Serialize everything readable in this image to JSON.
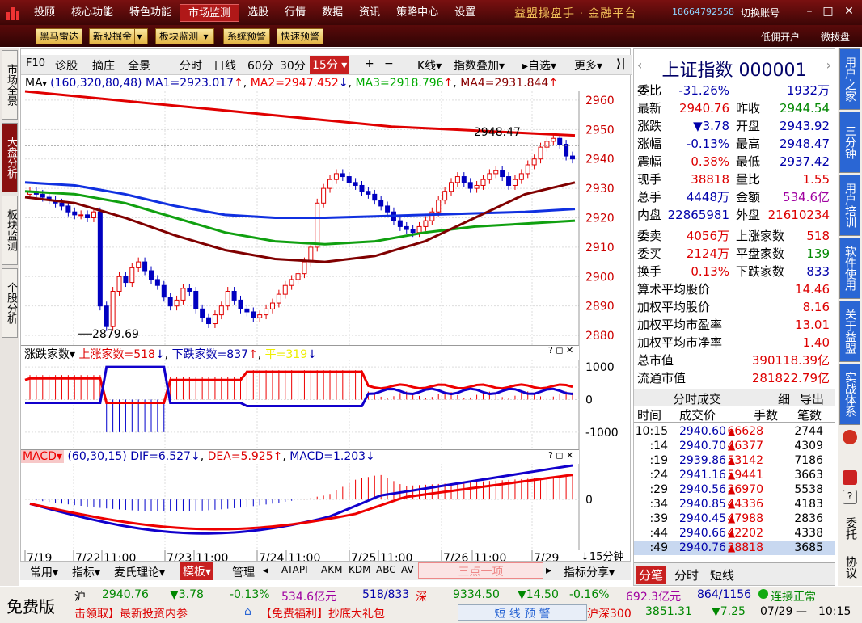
{
  "topbar": {
    "menu": [
      "投顾",
      "核心功能",
      "特色功能",
      "市场监测",
      "选股",
      "行情",
      "数据",
      "资讯",
      "策略中心",
      "设置"
    ],
    "active": "市场监测",
    "brand": "益盟操盘手 · 金融平台",
    "phone": "18664792558",
    "switch": "切换账号"
  },
  "toolbar2": {
    "buttons": [
      "黑马雷达",
      "新股掘金",
      "板块监测",
      "系统预警",
      "快速预警"
    ],
    "right": [
      "低佣开户",
      "微拨盘"
    ]
  },
  "left_tabs": [
    "市场全景",
    "大盘分析",
    "板块监测",
    "个股分析"
  ],
  "chart_toolbar": {
    "items": [
      "F10",
      "诊股",
      "摘庄",
      "全景",
      "分时",
      "日线",
      "60分",
      "30分",
      "15分",
      "+",
      "−",
      "K线",
      "指数叠加",
      "自选",
      "更多"
    ],
    "active": "15分"
  },
  "ma_header": {
    "label": "MA",
    "params": "(160,320,80,48)",
    "ma1": "MA1=2923.017",
    "ma2": "MA2=2947.452",
    "ma3": "MA3=2918.796",
    "ma4": "MA4=2931.844"
  },
  "price_axis": [
    "2960",
    "2950",
    "2940",
    "2930",
    "2920",
    "2910",
    "2900",
    "2890",
    "2880"
  ],
  "annotations": {
    "high": "2948.47",
    "low": "2879.69"
  },
  "breadth_header": {
    "label": "涨跌家数",
    "up": "上涨家数=518",
    "down": "下跌家数=837",
    "flat": "平=319"
  },
  "breadth_axis": [
    "1000",
    "0",
    "-1000"
  ],
  "macd_header": {
    "label": "MACD",
    "params": "(60,30,15)",
    "dif": "DIF=6.527",
    "dea": "DEA=5.925",
    "macd": "MACD=1.203"
  },
  "macd_axis": [
    "0"
  ],
  "date_axis": [
    "7/19",
    "7/22",
    "11:00",
    "7/23",
    "11:00",
    "7/24",
    "11:00",
    "7/25",
    "11:00",
    "7/26",
    "11:00",
    "7/29"
  ],
  "period_label": "15分钟",
  "bottom_tabs": [
    "常用",
    "指标",
    "麦氏理论",
    "模板",
    "管理",
    "ATAPI",
    "AKM",
    "KDM",
    "ABC",
    "AV",
    "三点一项",
    "指标分享"
  ],
  "quote": {
    "title": "上证指数",
    "code": "000001",
    "rows": [
      [
        "委比",
        "-31.26%",
        "",
        "1932万"
      ],
      [
        "最新",
        "2940.76",
        "昨收",
        "2944.54"
      ],
      [
        "涨跌",
        "▼3.78",
        "开盘",
        "2943.92"
      ],
      [
        "涨幅",
        "-0.13%",
        "最高",
        "2948.47"
      ],
      [
        "震幅",
        "0.38%",
        "最低",
        "2937.42"
      ],
      [
        "现手",
        "38818",
        "量比",
        "1.55"
      ],
      [
        "总手",
        "4448万",
        "金额",
        "534.6亿"
      ],
      [
        "内盘",
        "22865981",
        "外盘",
        "21610234"
      ],
      [
        "委卖",
        "4056万",
        "上涨家数",
        "518"
      ],
      [
        "委买",
        "2124万",
        "平盘家数",
        "139"
      ],
      [
        "换手",
        "0.13%",
        "下跌家数",
        "833"
      ]
    ],
    "stats": [
      [
        "算术平均股价",
        "14.46"
      ],
      [
        "加权平均股价",
        "8.16"
      ],
      [
        "加权平均市盈率",
        "13.01"
      ],
      [
        "加权平均市净率",
        "1.40"
      ],
      [
        "总市值",
        "390118.39亿"
      ],
      [
        "流通市值",
        "281822.79亿"
      ]
    ],
    "trades_title": "分时成交",
    "trades_tabs": [
      "细",
      "导出"
    ],
    "trades_cols": [
      "时间",
      "成交价",
      "手数",
      "笔数"
    ],
    "trades": [
      [
        "10:15",
        "2940.60",
        "66628",
        "2744"
      ],
      [
        ":14",
        "2940.70",
        "46377",
        "4309"
      ],
      [
        ":19",
        "2939.86",
        "53142",
        "7186"
      ],
      [
        ":24",
        "2941.16",
        "59441",
        "3663"
      ],
      [
        ":29",
        "2940.56",
        "36970",
        "5538"
      ],
      [
        ":34",
        "2940.85",
        "44336",
        "4183"
      ],
      [
        ":39",
        "2940.45",
        "47988",
        "2836"
      ],
      [
        ":44",
        "2940.66",
        "42202",
        "4338"
      ],
      [
        ":49",
        "2940.76",
        "38818",
        "3685"
      ]
    ],
    "bottom_tabs": [
      "分笔",
      "分时",
      "短线"
    ]
  },
  "right_tabs": [
    "用户之家",
    "三分钟",
    "用户培训",
    "软件使用",
    "关于益盟",
    "实战体系",
    "委托",
    "协议"
  ],
  "ticker": {
    "free": "免费版",
    "sh": "沪",
    "sh_price": "2940.76",
    "sh_chg": "▼3.78",
    "sh_pct": "-0.13%",
    "sh_amt": "534.6亿元",
    "sh_ud": "518/833",
    "sz": "深",
    "sz_price": "9334.50",
    "sz_chg": "▼14.50",
    "sz_pct": "-0.16%",
    "sz_amt": "692.3亿元",
    "sz_ud": "864/1156",
    "status": "连接正常",
    "news1": "击领取】最新投资内参",
    "news2": "【免费福利】抄底大礼包",
    "alert": "短 线 预 警",
    "hs300": "沪深300",
    "hs300_price": "3851.31",
    "hs300_chg": "▼7.25",
    "date": "07/29",
    "time": "10:15"
  },
  "colors": {
    "up": "#e00000",
    "down": "#0000d0",
    "ma_red": "#e00000",
    "ma_blue": "#1030e0",
    "ma_green": "#10a010",
    "ma_brown": "#800000"
  }
}
